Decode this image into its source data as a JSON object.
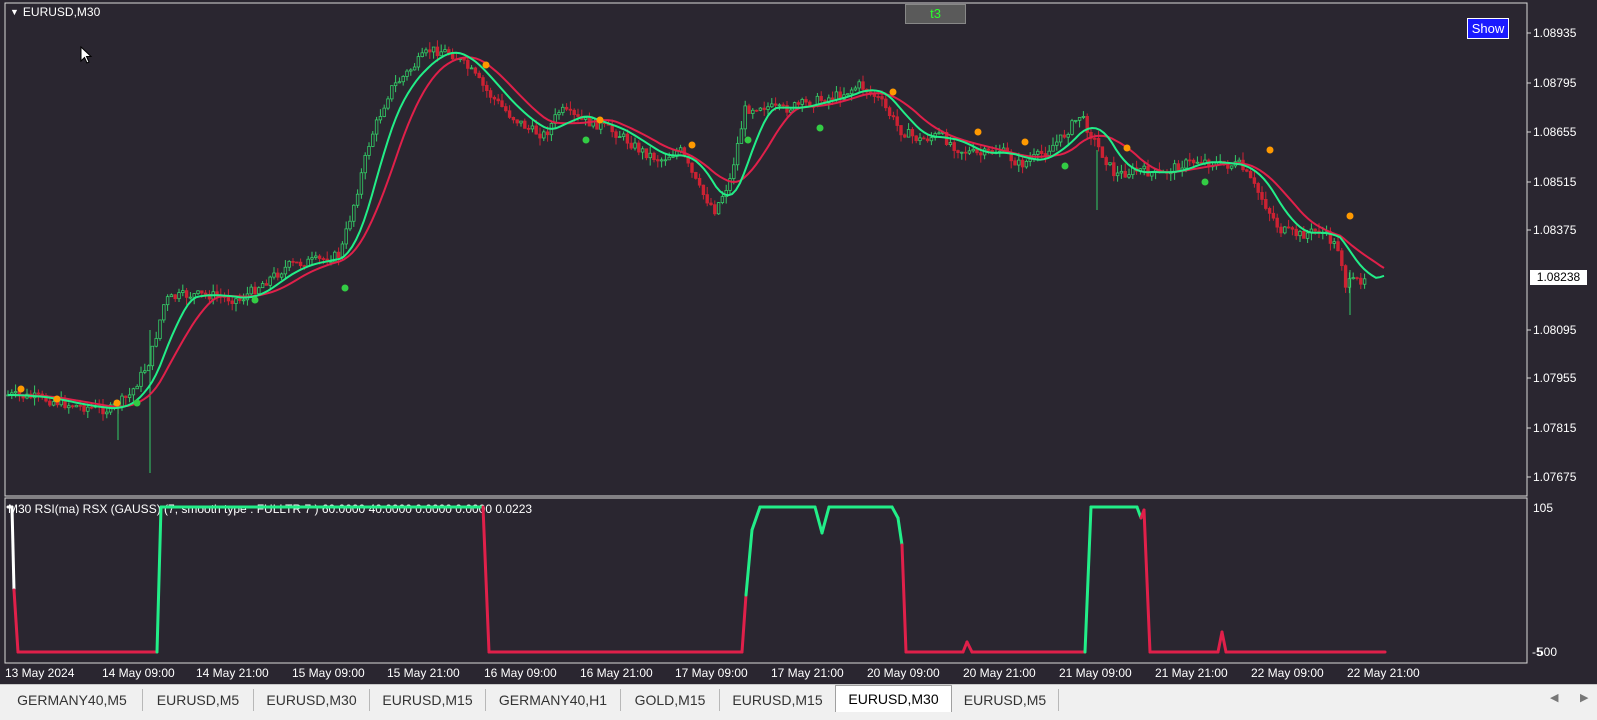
{
  "window": {
    "symbol_title": "EURUSD,M30"
  },
  "top_label": "t3",
  "show_button": "Show",
  "price_axis": {
    "ticks": [
      "1.08935",
      "1.08795",
      "1.08655",
      "1.08515",
      "1.08375",
      "1.08238",
      "1.08095",
      "1.07955",
      "1.07815",
      "1.07675"
    ],
    "current_price": "1.08238"
  },
  "indicator": {
    "label": "M30 RSI(ma) RSX (GAUSS) (7, smooth type : FULLTR  7 ) 60.0000 40.0000 0.0000 0.0000 0.0223",
    "scale_top": "105",
    "scale_bottom": "-5",
    "scale_bottom_overlap": "500"
  },
  "time_axis": [
    "13 May 2024",
    "14 May 09:00",
    "14 May 21:00",
    "15 May 09:00",
    "15 May 21:00",
    "16 May 09:00",
    "16 May 21:00",
    "17 May 09:00",
    "17 May 21:00",
    "20 May 09:00",
    "20 May 21:00",
    "21 May 09:00",
    "21 May 21:00",
    "22 May 09:00",
    "22 May 21:00"
  ],
  "tabs": [
    "GERMANY40,M5",
    "EURUSD,M5",
    "EURUSD,M30",
    "EURUSD,M15",
    "GERMANY40,H1",
    "GOLD,M15",
    "EURUSD,M15",
    "EURUSD,M30",
    "EURUSD,M5"
  ],
  "active_tab_index": 7,
  "colors": {
    "background": "#2a2630",
    "bull_candle": "#33cc66",
    "bear_candle": "#cc2233",
    "fast_line": "#22ee88",
    "slow_line": "#e0204a",
    "signal_up": "#33cc44",
    "signal_down": "#ff9900",
    "show_button": "#1a1aff"
  },
  "icons": {
    "collapse": "triangle-down-icon",
    "cursor": "mouse-pointer-icon",
    "scroll_left": "chevron-left-icon",
    "scroll_right": "chevron-right-icon"
  }
}
